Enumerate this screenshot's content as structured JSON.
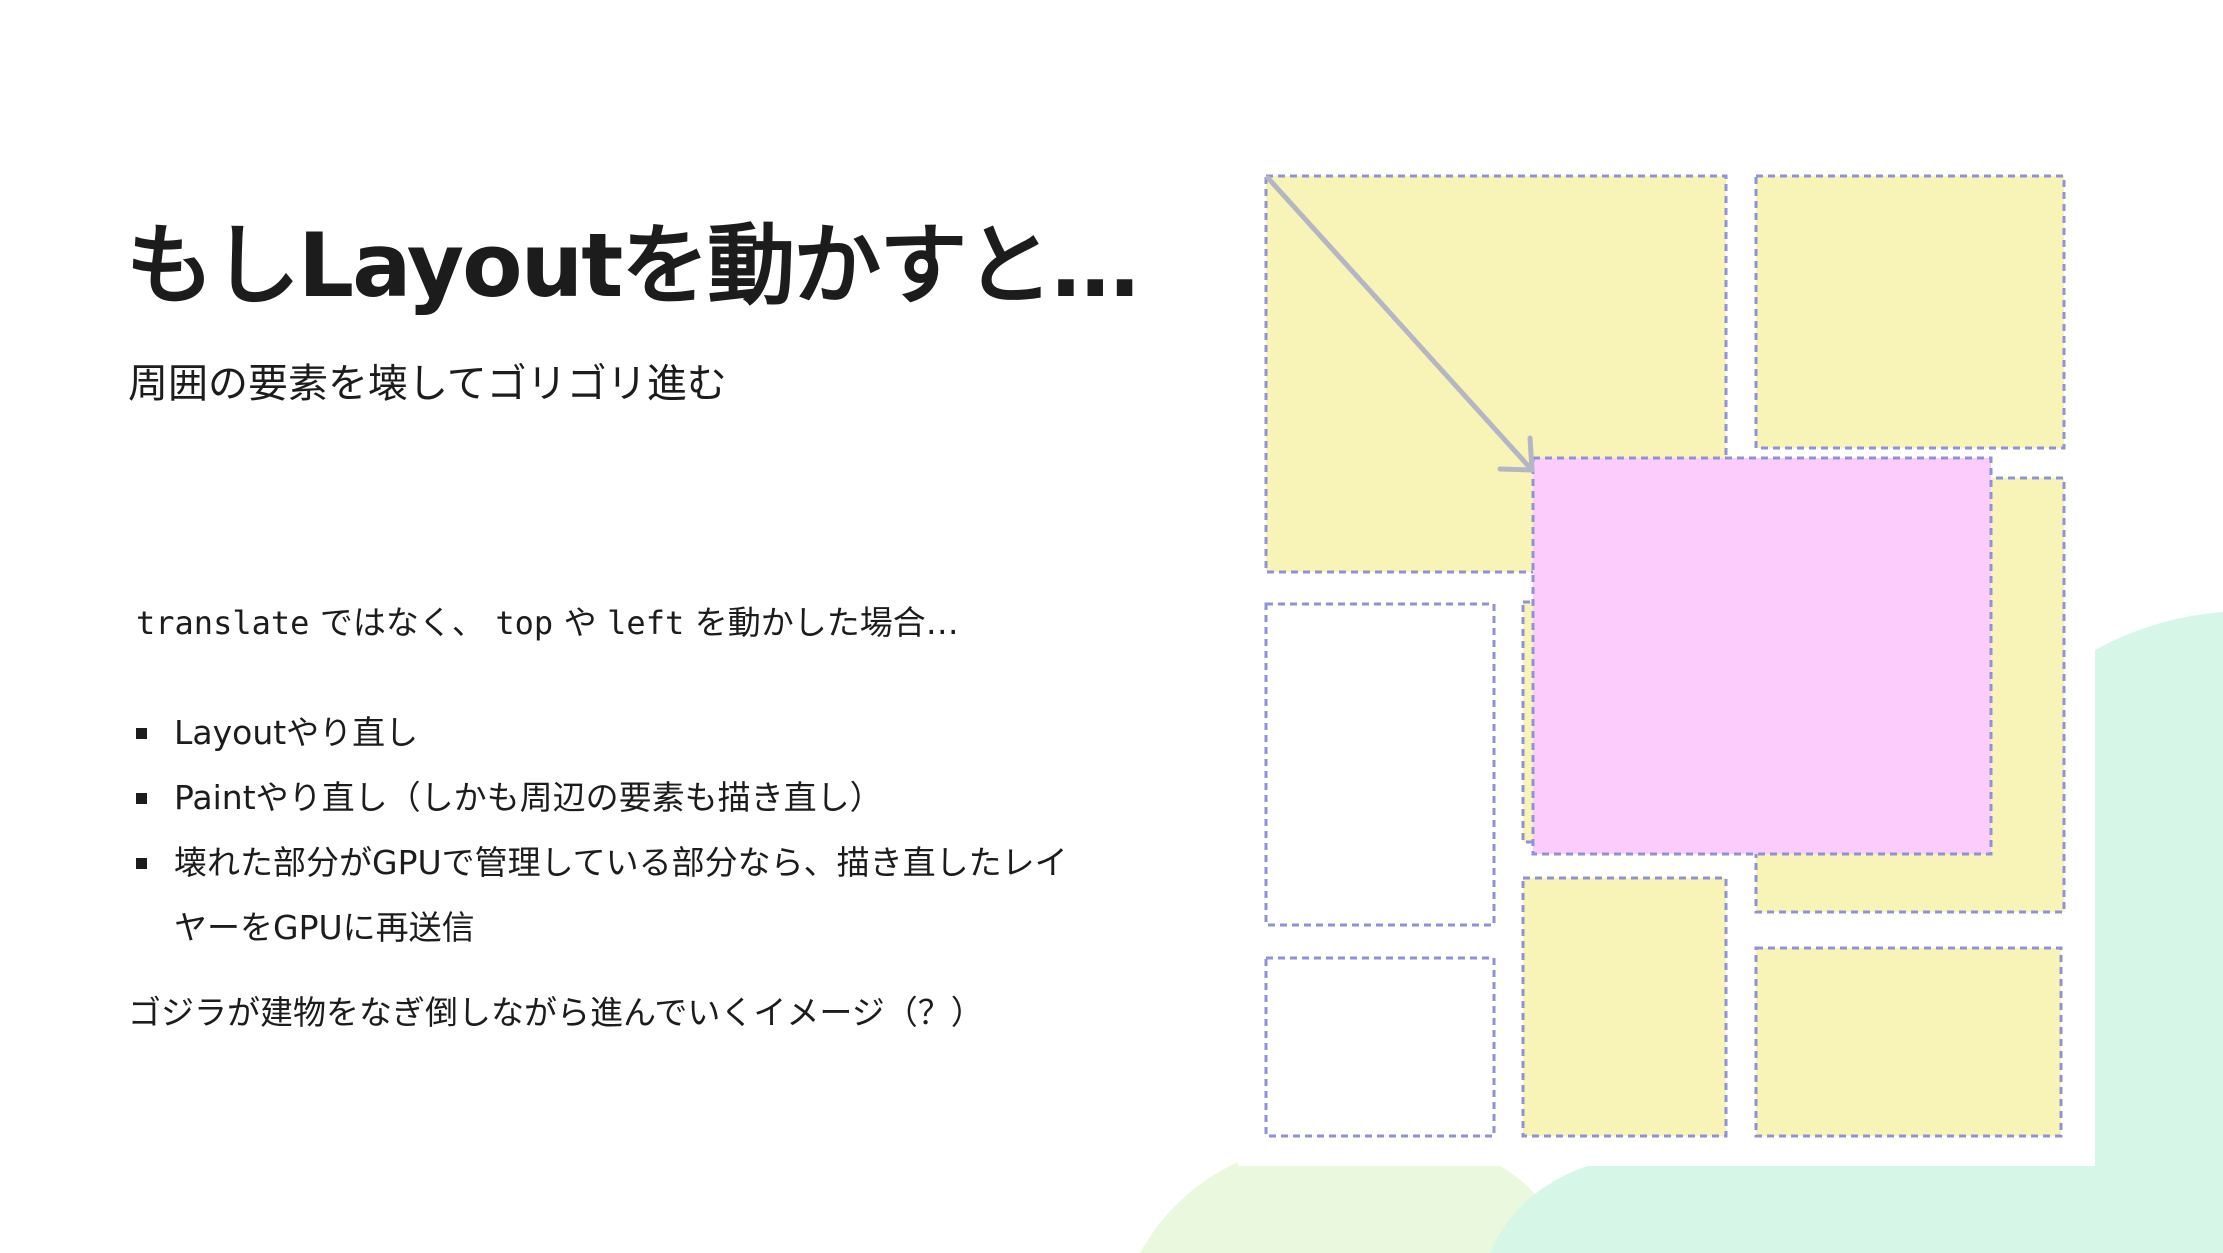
{
  "slide": {
    "title": "もしLayoutを動かすと…",
    "subtitle": "周囲の要素を壊してゴリゴリ進む",
    "intro": {
      "code_translate": "translate",
      "text_1": " ではなく、 ",
      "code_top": "top",
      "text_2": " や ",
      "code_left": "left",
      "text_3": " を動かした場合…"
    },
    "bullets": [
      "Layoutやり直し",
      "Paintやり直し（しかも周辺の要素も描き直し）",
      "壊れた部分がGPUで管理している部分なら、描き直したレイヤーをGPUに再送信"
    ],
    "closing": "ゴジラが建物をなぎ倒しながら進んでいくイメージ（？）"
  },
  "colors": {
    "block_fill": "#f8f4b8",
    "empty_fill": "#ffffff",
    "moved_fill": "#fccdfc",
    "dashed_border": "#8e93d8",
    "arrow": "#b4b6c4",
    "deco_green": "#d6f7e8",
    "deco_lime": "#eaf8de"
  }
}
